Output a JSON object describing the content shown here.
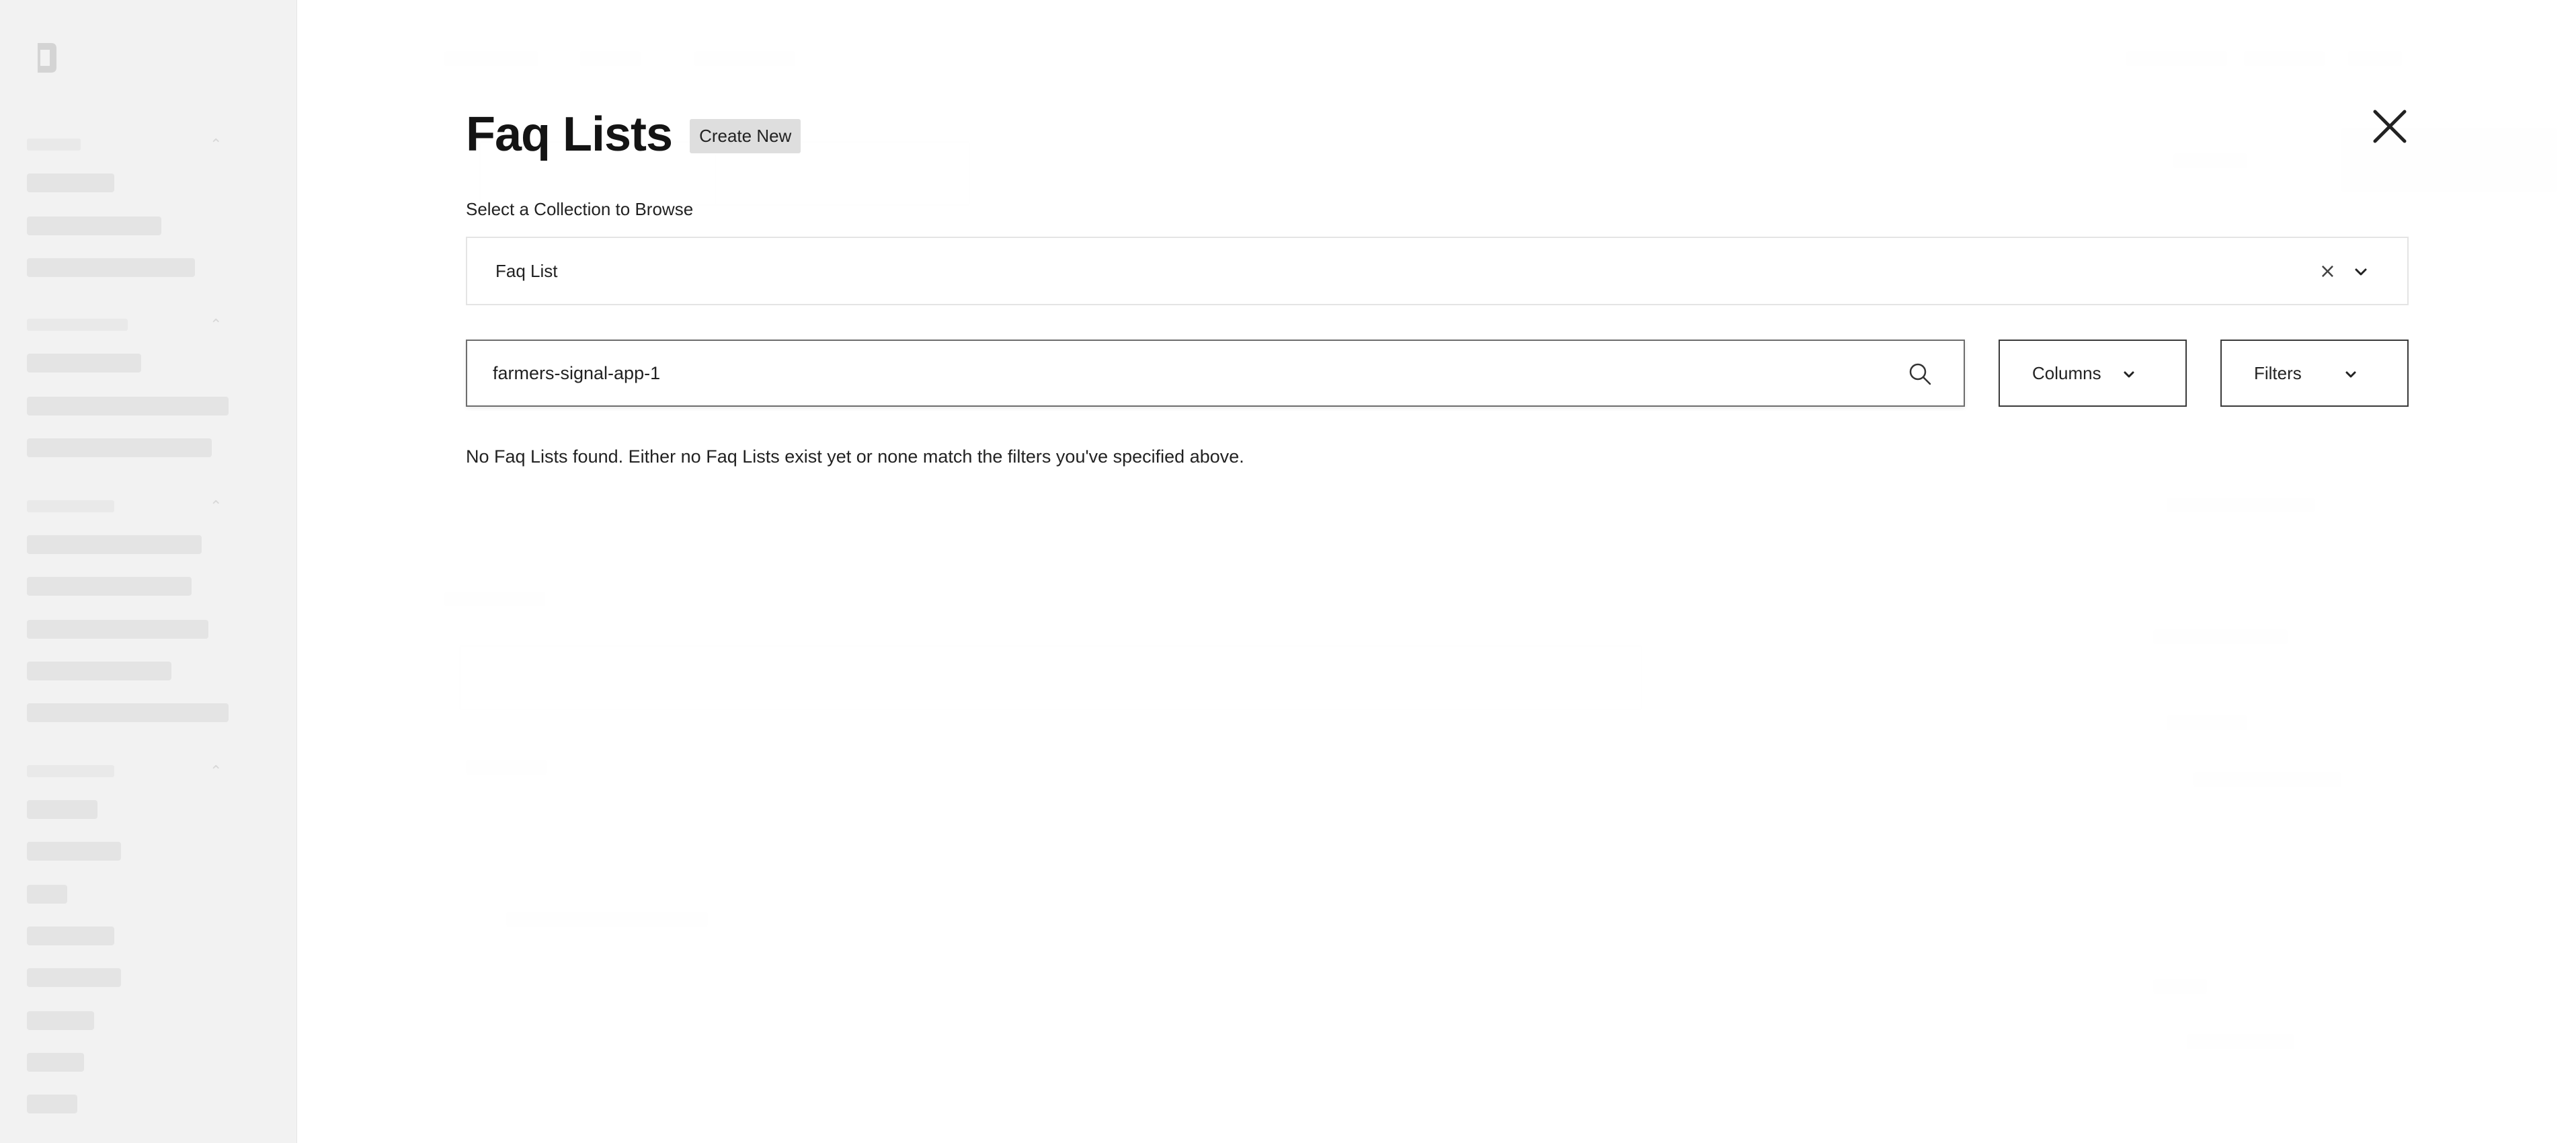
{
  "drawer": {
    "title": "Faq Lists",
    "create_label": "Create New",
    "collection_label": "Select a Collection to Browse",
    "collection_value": "Faq List",
    "clear_glyph": "×",
    "search_value": "farmers-signal-app-1",
    "columns_label": "Columns",
    "filters_label": "Filters",
    "empty_message": "No Faq Lists found. Either no Faq Lists exist yet or none match the filters you've specified above."
  },
  "icons": {
    "close": "close-icon",
    "clear": "clear-icon",
    "chevron": "chevron-down-icon",
    "search": "search-icon",
    "logo": "logo-icon"
  },
  "colors": {
    "sidebar_bg": "#f2f2f2",
    "select_border": "#e4e4e4",
    "search_border": "#6d6d6d",
    "button_border": "#3a3a3a",
    "create_bg": "#dedede"
  }
}
